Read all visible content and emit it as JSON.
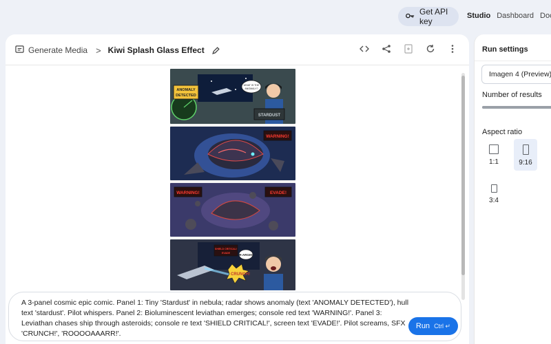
{
  "topbar": {
    "api_key_label": "Get API key",
    "nav": [
      "Studio",
      "Dashboard",
      "Docum"
    ]
  },
  "toolbar": {
    "breadcrumb_root": "Generate Media",
    "separator": ">",
    "title": "Kiwi Splash Glass Effect",
    "icons": [
      "code-icon",
      "share-icon",
      "compare-icon",
      "refresh-icon",
      "more-vert-icon"
    ]
  },
  "comic": {
    "panel1": {
      "anomaly_text": "ANOMALY DETECTED",
      "bubble_text": "WHAT IS THE ANOMALY?",
      "hull_text": "STARDUST"
    },
    "panel2": {
      "warning_text": "WARNING!"
    },
    "panel3": {
      "warning_text": "WARNING!",
      "evade_text": "EVADE!"
    },
    "panel4": {
      "shield_text": "SHIELD CRITICAL!",
      "evade_text": "EVADE",
      "scream_text": "R-ARGH!",
      "sfx_text": "CRUNCH!"
    }
  },
  "prompt": {
    "text": "A 3-panel cosmic epic comic. Panel 1: Tiny 'Stardust' in nebula; radar shows anomaly (text 'ANOMALY DETECTED'), hull text 'stardust'. Pilot whispers. Panel 2: Bioluminescent leviathan emerges; console red text 'WARNING!'. Panel 3: Leviathan chases ship through asteroids; console re text 'SHIELD CRITICAL!', screen text 'EVADE!'. Pilot screams, SFX 'CRUNCH!', 'ROOOOAAARR!'.",
    "run_label": "Run",
    "run_shortcut": "Ctrl ↵"
  },
  "run_settings": {
    "title": "Run settings",
    "model": "Imagen 4 (Preview)",
    "num_results_label": "Number of results",
    "num_results_fill": 1.0,
    "aspect_ratio_label": "Aspect ratio",
    "aspect_ratios": [
      "1:1",
      "9:16",
      "3:4"
    ],
    "selected_aspect_ratio": "9:16"
  },
  "colors": {
    "accent": "#1a73e8",
    "background": "#eef1f7",
    "api_button": "#dde3f0",
    "selected_option": "#e8eef9"
  }
}
